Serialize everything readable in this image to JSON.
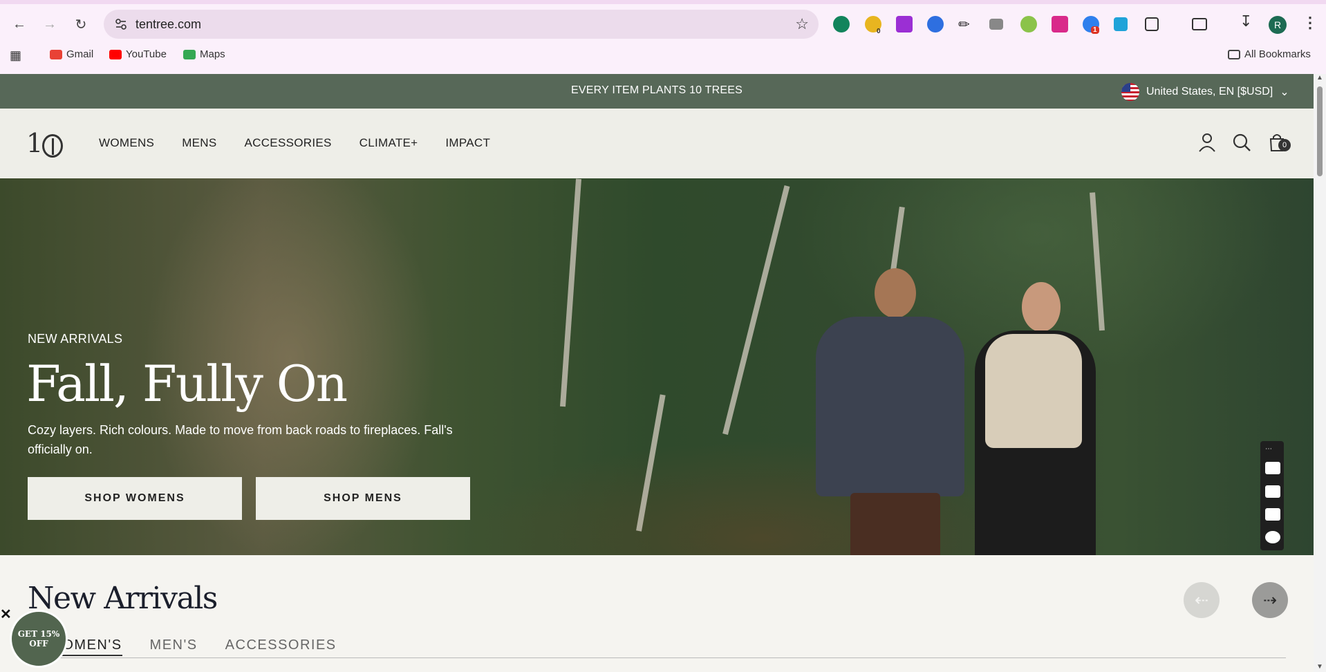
{
  "browser": {
    "url": "tentree.com",
    "extension_badges": [
      "0",
      "1"
    ],
    "profile_initial": "R",
    "bookmarks": [
      "Gmail",
      "YouTube",
      "Maps"
    ],
    "all_bookmarks": "All Bookmarks"
  },
  "announcement": {
    "message": "EVERY ITEM PLANTS 10 TREES",
    "locale": "United States, EN [$USD]"
  },
  "header": {
    "logo": "1",
    "nav": [
      "WOMENS",
      "MENS",
      "ACCESSORIES",
      "CLIMATE+",
      "IMPACT"
    ],
    "cart_count": "0"
  },
  "hero": {
    "eyebrow": "NEW ARRIVALS",
    "title": "Fall, Fully On",
    "subtitle": "Cozy layers. Rich colours. Made to move from back roads to fireplaces. Fall's officially on.",
    "buttons": [
      "SHOP WOMENS",
      "SHOP MENS"
    ]
  },
  "new_arrivals": {
    "title": "New Arrivals",
    "tabs": [
      "WOMEN'S",
      "MEN'S",
      "ACCESSORIES"
    ],
    "prev_arrow": "⇠",
    "next_arrow": "⇢"
  },
  "promo": {
    "label": "GET 15% OFF",
    "close": "✕"
  }
}
